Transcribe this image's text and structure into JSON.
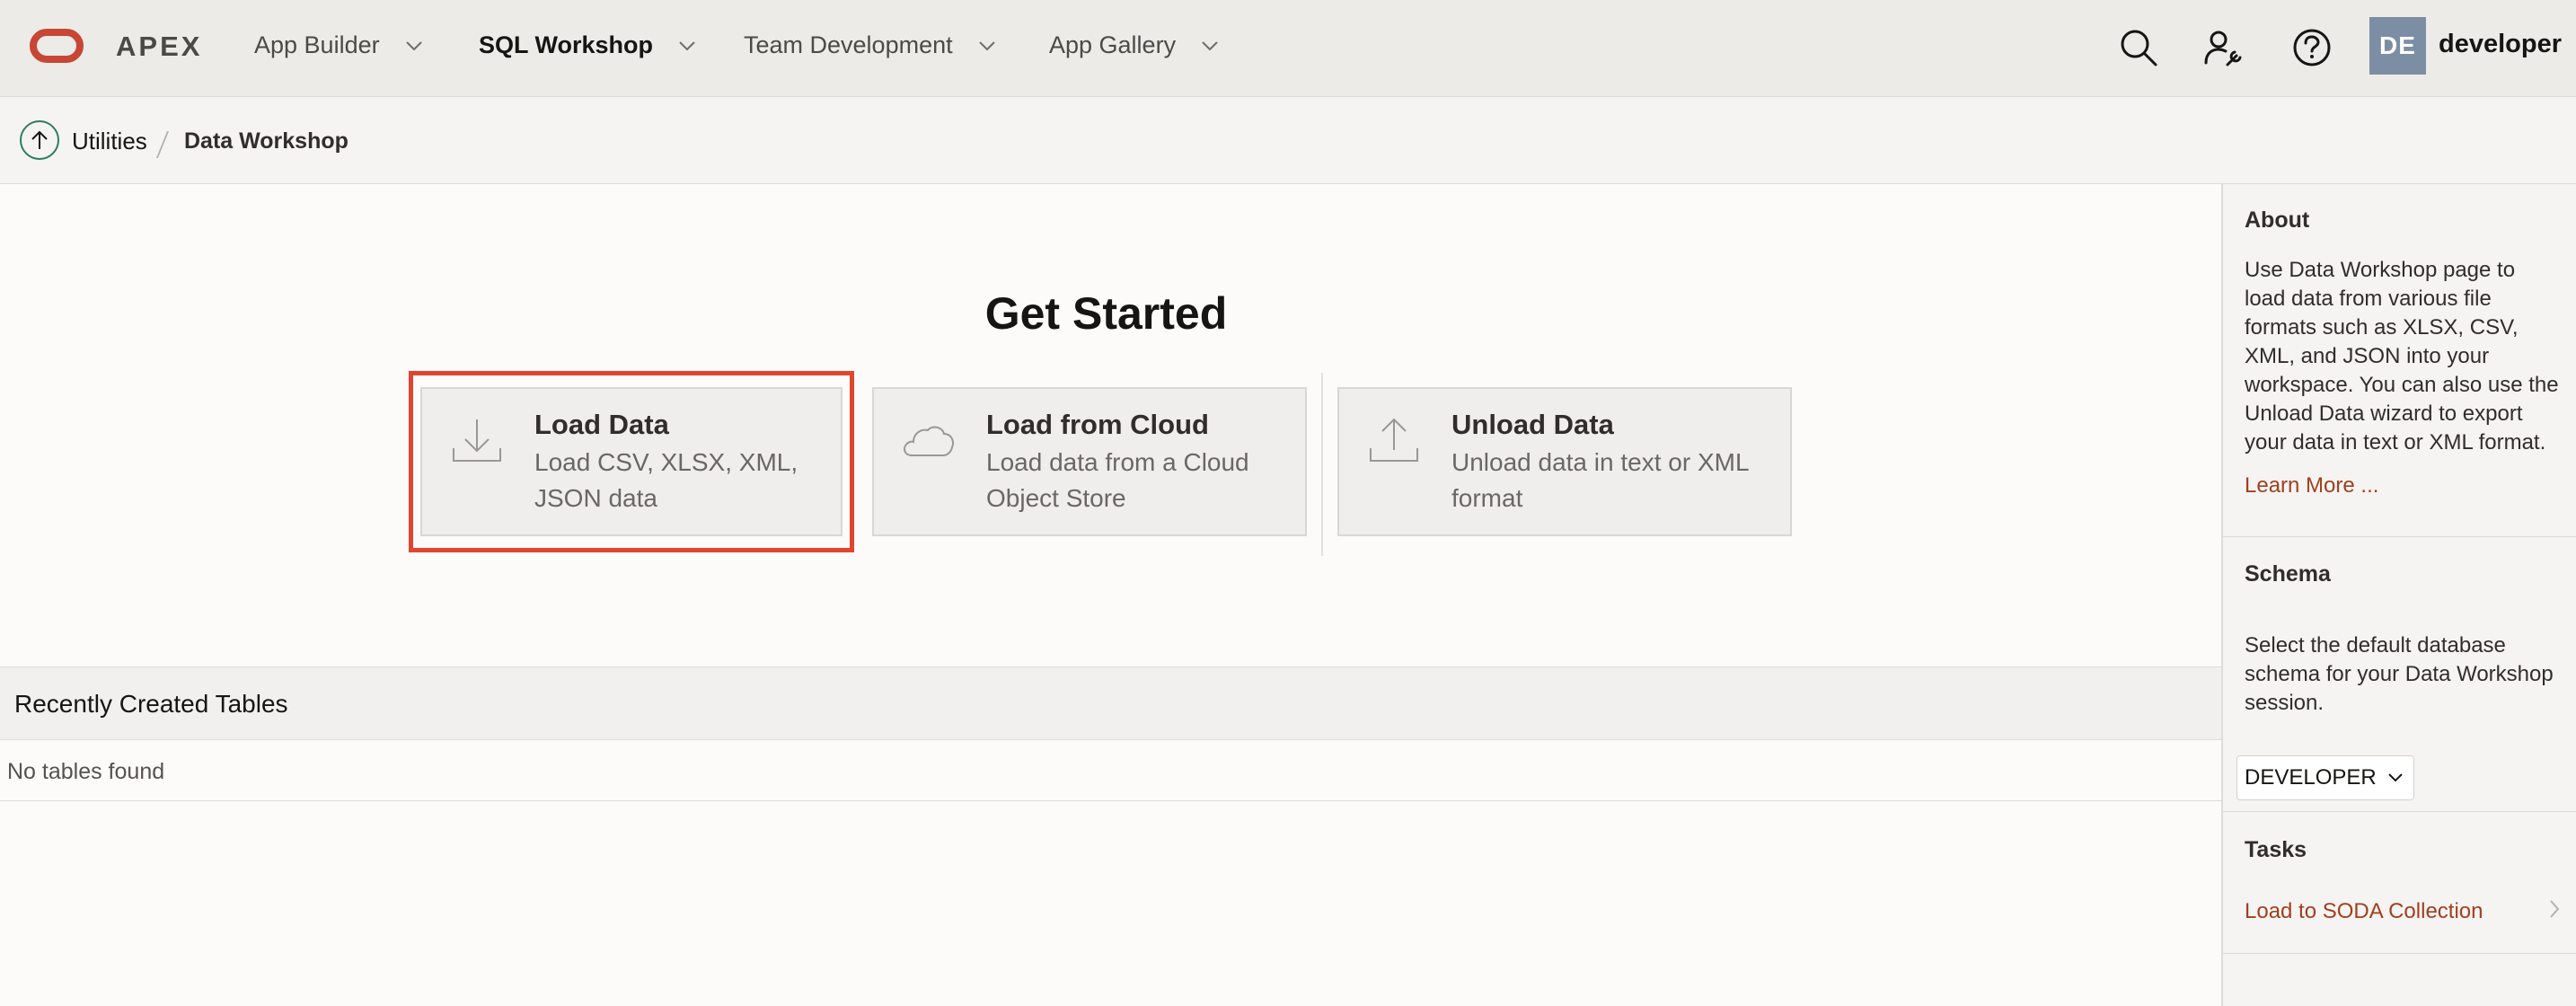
{
  "header": {
    "brand": "APEX",
    "nav": [
      {
        "label": "App Builder",
        "active": false
      },
      {
        "label": "SQL Workshop",
        "active": true
      },
      {
        "label": "Team Development",
        "active": false
      },
      {
        "label": "App Gallery",
        "active": false
      }
    ],
    "icons": [
      "search-icon",
      "admin-user-icon",
      "help-icon"
    ],
    "avatar_initials": "DE",
    "username": "developer"
  },
  "breadcrumb": {
    "parent": "Utilities",
    "current": "Data Workshop"
  },
  "main": {
    "heading": "Get Started",
    "cards": [
      {
        "title": "Load Data",
        "desc_line1": "Load CSV, XLSX, XML,",
        "desc_line2": "JSON data",
        "icon": "download-icon",
        "highlighted": true
      },
      {
        "title": "Load from Cloud",
        "desc_line1": "Load data from a Cloud",
        "desc_line2": "Object Store",
        "icon": "cloud-icon",
        "highlighted": false
      },
      {
        "title": "Unload Data",
        "desc_line1": "Unload data in text or XML",
        "desc_line2": "format",
        "icon": "upload-icon",
        "highlighted": false
      }
    ],
    "recent_tables": {
      "title": "Recently Created Tables",
      "empty_message": "No tables found"
    }
  },
  "side": {
    "about": {
      "heading": "About",
      "lines": [
        "Use Data Workshop page to",
        "load data from various file",
        "formats such as XLSX, CSV,",
        "XML, and JSON into your",
        "workspace. You can also use the",
        "Unload Data wizard to export",
        "your data in text or XML format."
      ],
      "link": "Learn More ..."
    },
    "schema": {
      "heading": "Schema",
      "lines": [
        "Select the default database",
        "schema for your Data Workshop",
        "session."
      ],
      "selected": "DEVELOPER"
    },
    "tasks": {
      "heading": "Tasks",
      "items": [
        "Load to SODA Collection"
      ]
    }
  },
  "colors": {
    "brand_red": "#c74634",
    "highlight_red": "#e0462f",
    "link": "#a13f1f",
    "avatar": "#7c8ea3"
  }
}
